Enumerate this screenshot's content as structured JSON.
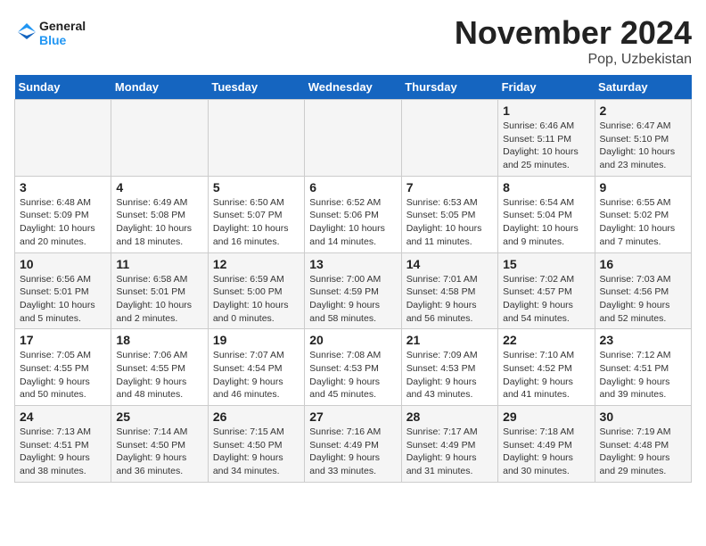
{
  "header": {
    "logo_line1": "General",
    "logo_line2": "Blue",
    "month": "November 2024",
    "location": "Pop, Uzbekistan"
  },
  "days_of_week": [
    "Sunday",
    "Monday",
    "Tuesday",
    "Wednesday",
    "Thursday",
    "Friday",
    "Saturday"
  ],
  "weeks": [
    [
      {
        "day": "",
        "info": ""
      },
      {
        "day": "",
        "info": ""
      },
      {
        "day": "",
        "info": ""
      },
      {
        "day": "",
        "info": ""
      },
      {
        "day": "",
        "info": ""
      },
      {
        "day": "1",
        "info": "Sunrise: 6:46 AM\nSunset: 5:11 PM\nDaylight: 10 hours and 25 minutes."
      },
      {
        "day": "2",
        "info": "Sunrise: 6:47 AM\nSunset: 5:10 PM\nDaylight: 10 hours and 23 minutes."
      }
    ],
    [
      {
        "day": "3",
        "info": "Sunrise: 6:48 AM\nSunset: 5:09 PM\nDaylight: 10 hours and 20 minutes."
      },
      {
        "day": "4",
        "info": "Sunrise: 6:49 AM\nSunset: 5:08 PM\nDaylight: 10 hours and 18 minutes."
      },
      {
        "day": "5",
        "info": "Sunrise: 6:50 AM\nSunset: 5:07 PM\nDaylight: 10 hours and 16 minutes."
      },
      {
        "day": "6",
        "info": "Sunrise: 6:52 AM\nSunset: 5:06 PM\nDaylight: 10 hours and 14 minutes."
      },
      {
        "day": "7",
        "info": "Sunrise: 6:53 AM\nSunset: 5:05 PM\nDaylight: 10 hours and 11 minutes."
      },
      {
        "day": "8",
        "info": "Sunrise: 6:54 AM\nSunset: 5:04 PM\nDaylight: 10 hours and 9 minutes."
      },
      {
        "day": "9",
        "info": "Sunrise: 6:55 AM\nSunset: 5:02 PM\nDaylight: 10 hours and 7 minutes."
      }
    ],
    [
      {
        "day": "10",
        "info": "Sunrise: 6:56 AM\nSunset: 5:01 PM\nDaylight: 10 hours and 5 minutes."
      },
      {
        "day": "11",
        "info": "Sunrise: 6:58 AM\nSunset: 5:01 PM\nDaylight: 10 hours and 2 minutes."
      },
      {
        "day": "12",
        "info": "Sunrise: 6:59 AM\nSunset: 5:00 PM\nDaylight: 10 hours and 0 minutes."
      },
      {
        "day": "13",
        "info": "Sunrise: 7:00 AM\nSunset: 4:59 PM\nDaylight: 9 hours and 58 minutes."
      },
      {
        "day": "14",
        "info": "Sunrise: 7:01 AM\nSunset: 4:58 PM\nDaylight: 9 hours and 56 minutes."
      },
      {
        "day": "15",
        "info": "Sunrise: 7:02 AM\nSunset: 4:57 PM\nDaylight: 9 hours and 54 minutes."
      },
      {
        "day": "16",
        "info": "Sunrise: 7:03 AM\nSunset: 4:56 PM\nDaylight: 9 hours and 52 minutes."
      }
    ],
    [
      {
        "day": "17",
        "info": "Sunrise: 7:05 AM\nSunset: 4:55 PM\nDaylight: 9 hours and 50 minutes."
      },
      {
        "day": "18",
        "info": "Sunrise: 7:06 AM\nSunset: 4:55 PM\nDaylight: 9 hours and 48 minutes."
      },
      {
        "day": "19",
        "info": "Sunrise: 7:07 AM\nSunset: 4:54 PM\nDaylight: 9 hours and 46 minutes."
      },
      {
        "day": "20",
        "info": "Sunrise: 7:08 AM\nSunset: 4:53 PM\nDaylight: 9 hours and 45 minutes."
      },
      {
        "day": "21",
        "info": "Sunrise: 7:09 AM\nSunset: 4:53 PM\nDaylight: 9 hours and 43 minutes."
      },
      {
        "day": "22",
        "info": "Sunrise: 7:10 AM\nSunset: 4:52 PM\nDaylight: 9 hours and 41 minutes."
      },
      {
        "day": "23",
        "info": "Sunrise: 7:12 AM\nSunset: 4:51 PM\nDaylight: 9 hours and 39 minutes."
      }
    ],
    [
      {
        "day": "24",
        "info": "Sunrise: 7:13 AM\nSunset: 4:51 PM\nDaylight: 9 hours and 38 minutes."
      },
      {
        "day": "25",
        "info": "Sunrise: 7:14 AM\nSunset: 4:50 PM\nDaylight: 9 hours and 36 minutes."
      },
      {
        "day": "26",
        "info": "Sunrise: 7:15 AM\nSunset: 4:50 PM\nDaylight: 9 hours and 34 minutes."
      },
      {
        "day": "27",
        "info": "Sunrise: 7:16 AM\nSunset: 4:49 PM\nDaylight: 9 hours and 33 minutes."
      },
      {
        "day": "28",
        "info": "Sunrise: 7:17 AM\nSunset: 4:49 PM\nDaylight: 9 hours and 31 minutes."
      },
      {
        "day": "29",
        "info": "Sunrise: 7:18 AM\nSunset: 4:49 PM\nDaylight: 9 hours and 30 minutes."
      },
      {
        "day": "30",
        "info": "Sunrise: 7:19 AM\nSunset: 4:48 PM\nDaylight: 9 hours and 29 minutes."
      }
    ]
  ]
}
